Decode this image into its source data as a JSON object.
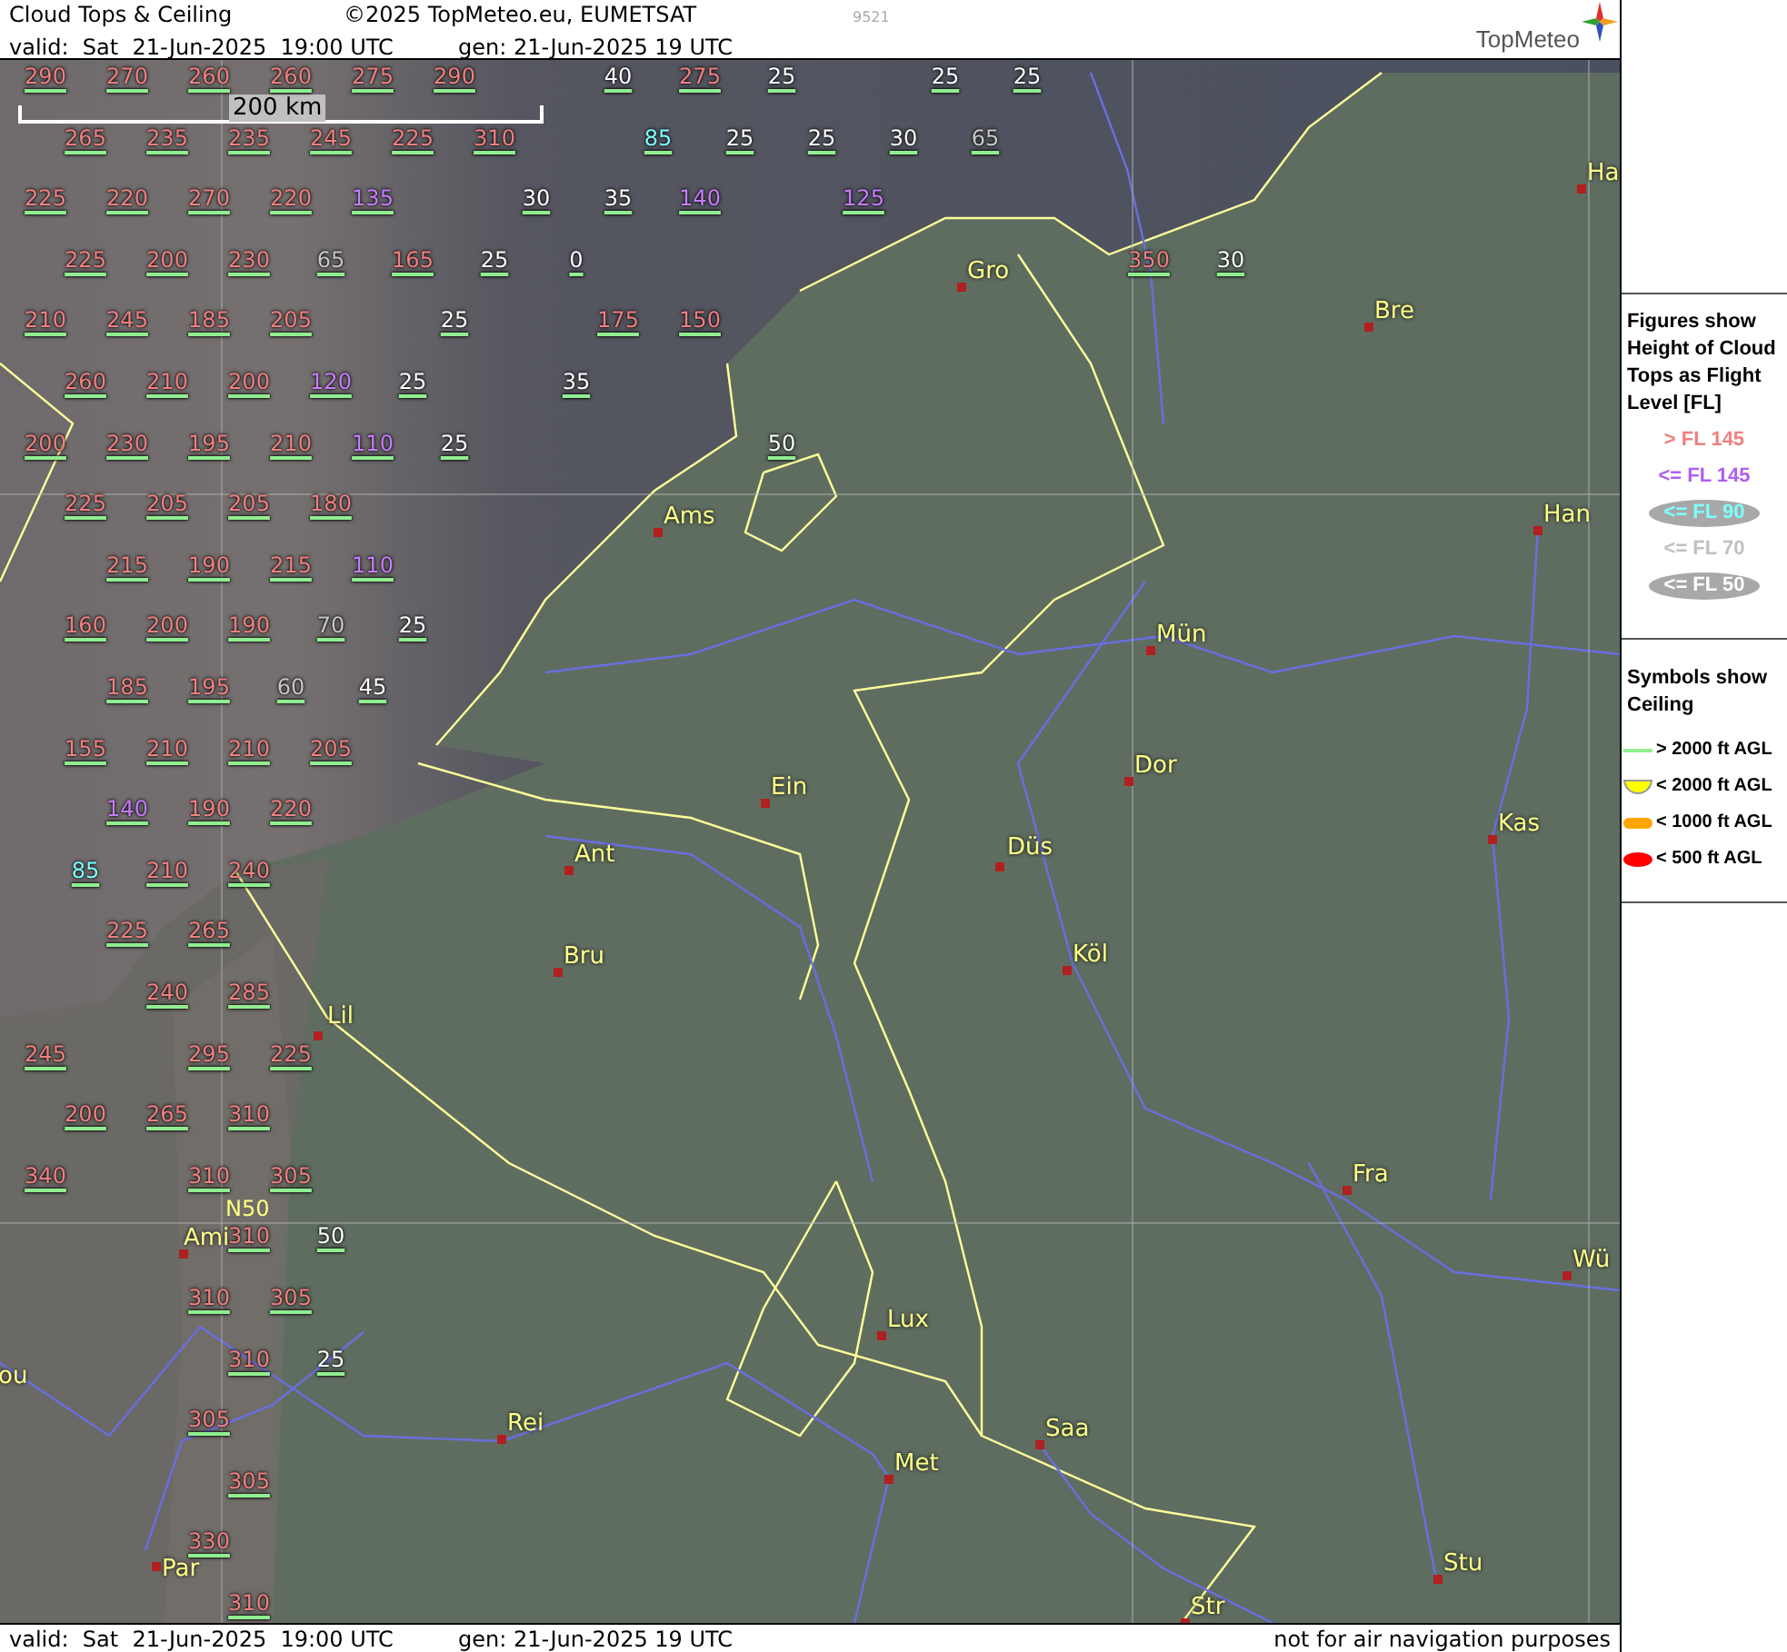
{
  "header": {
    "title": "Cloud Tops & Ceiling",
    "copyright": "©2025 TopMeteo.eu, EUMETSAT",
    "image_id": "9521",
    "valid": "valid:  Sat  21-Jun-2025  19:00 UTC",
    "generated": "gen: 21-Jun-2025 19 UTC",
    "logo": "TopMeteo"
  },
  "map": {
    "scale_bar": "200 km",
    "grid_label": "N50",
    "label_rows": [
      [
        {
          "text": "290",
          "kind": "gt145"
        },
        {
          "text": "270",
          "kind": "gt145"
        },
        {
          "text": "260",
          "kind": "gt145"
        },
        {
          "text": "260",
          "kind": "gt145"
        },
        {
          "text": "275",
          "kind": "gt145"
        },
        {
          "text": "290",
          "kind": "gt145"
        },
        {
          "text": "40",
          "kind": "le50"
        },
        {
          "text": "275",
          "kind": "gt145"
        },
        {
          "text": "25",
          "kind": "le50"
        },
        {
          "text": "25",
          "kind": "le50"
        },
        {
          "text": "25",
          "kind": "le50"
        }
      ],
      [
        {
          "text": "265",
          "kind": "gt145"
        },
        {
          "text": "235",
          "kind": "gt145"
        },
        {
          "text": "235",
          "kind": "gt145"
        },
        {
          "text": "245",
          "kind": "gt145"
        },
        {
          "text": "225",
          "kind": "gt145"
        },
        {
          "text": "310",
          "kind": "gt145"
        },
        {
          "text": "85",
          "kind": "le90"
        },
        {
          "text": "25",
          "kind": "le50"
        },
        {
          "text": "25",
          "kind": "le50"
        },
        {
          "text": "30",
          "kind": "le50"
        },
        {
          "text": "65",
          "kind": "le70"
        }
      ],
      [
        {
          "text": "225",
          "kind": "gt145"
        },
        {
          "text": "220",
          "kind": "gt145"
        },
        {
          "text": "270",
          "kind": "gt145"
        },
        {
          "text": "220",
          "kind": "gt145"
        },
        {
          "text": "135",
          "kind": "le145"
        },
        {
          "text": "30",
          "kind": "le50"
        },
        {
          "text": "35",
          "kind": "le50"
        },
        {
          "text": "140",
          "kind": "le145"
        },
        {
          "text": "125",
          "kind": "le145"
        }
      ],
      [
        {
          "text": "225",
          "kind": "gt145"
        },
        {
          "text": "200",
          "kind": "gt145"
        },
        {
          "text": "230",
          "kind": "gt145"
        },
        {
          "text": "65",
          "kind": "le70"
        },
        {
          "text": "165",
          "kind": "gt145"
        },
        {
          "text": "25",
          "kind": "le50"
        },
        {
          "text": "0",
          "kind": "le50"
        },
        {
          "text": "350",
          "kind": "gt145"
        },
        {
          "text": "30",
          "kind": "le50"
        }
      ],
      [
        {
          "text": "210",
          "kind": "gt145"
        },
        {
          "text": "245",
          "kind": "gt145"
        },
        {
          "text": "185",
          "kind": "gt145"
        },
        {
          "text": "205",
          "kind": "gt145"
        },
        {
          "text": "25",
          "kind": "le50"
        },
        {
          "text": "175",
          "kind": "gt145"
        },
        {
          "text": "150",
          "kind": "gt145"
        }
      ],
      [
        {
          "text": "260",
          "kind": "gt145"
        },
        {
          "text": "210",
          "kind": "gt145"
        },
        {
          "text": "200",
          "kind": "gt145"
        },
        {
          "text": "120",
          "kind": "le145"
        },
        {
          "text": "25",
          "kind": "le50"
        },
        {
          "text": "35",
          "kind": "le50"
        }
      ],
      [
        {
          "text": "200",
          "kind": "gt145"
        },
        {
          "text": "230",
          "kind": "gt145"
        },
        {
          "text": "195",
          "kind": "gt145"
        },
        {
          "text": "210",
          "kind": "gt145"
        },
        {
          "text": "110",
          "kind": "le145"
        },
        {
          "text": "25",
          "kind": "le50"
        },
        {
          "text": "50",
          "kind": "le50"
        }
      ],
      [
        {
          "text": "225",
          "kind": "gt145"
        },
        {
          "text": "205",
          "kind": "gt145"
        },
        {
          "text": "205",
          "kind": "gt145"
        },
        {
          "text": "180",
          "kind": "gt145"
        }
      ],
      [
        {
          "text": "215",
          "kind": "gt145"
        },
        {
          "text": "190",
          "kind": "gt145"
        },
        {
          "text": "215",
          "kind": "gt145"
        },
        {
          "text": "110",
          "kind": "le145"
        }
      ],
      [
        {
          "text": "160",
          "kind": "gt145"
        },
        {
          "text": "200",
          "kind": "gt145"
        },
        {
          "text": "190",
          "kind": "gt145"
        },
        {
          "text": "70",
          "kind": "le70"
        },
        {
          "text": "25",
          "kind": "le50"
        }
      ],
      [
        {
          "text": "185",
          "kind": "gt145"
        },
        {
          "text": "195",
          "kind": "gt145"
        },
        {
          "text": "60",
          "kind": "le70"
        },
        {
          "text": "45",
          "kind": "le50"
        }
      ],
      [
        {
          "text": "155",
          "kind": "gt145"
        },
        {
          "text": "210",
          "kind": "gt145"
        },
        {
          "text": "210",
          "kind": "gt145"
        },
        {
          "text": "205",
          "kind": "gt145"
        }
      ],
      [
        {
          "text": "140",
          "kind": "le145"
        },
        {
          "text": "190",
          "kind": "gt145"
        },
        {
          "text": "220",
          "kind": "gt145"
        }
      ],
      [
        {
          "text": "85",
          "kind": "le90"
        },
        {
          "text": "210",
          "kind": "gt145"
        },
        {
          "text": "240",
          "kind": "gt145"
        }
      ],
      [
        {
          "text": "225",
          "kind": "gt145"
        },
        {
          "text": "265",
          "kind": "gt145"
        }
      ],
      [
        {
          "text": "240",
          "kind": "gt145"
        },
        {
          "text": "285",
          "kind": "gt145"
        }
      ],
      [
        {
          "text": "245",
          "kind": "gt145"
        },
        {
          "text": "295",
          "kind": "gt145"
        },
        {
          "text": "225",
          "kind": "gt145"
        }
      ],
      [
        {
          "text": "200",
          "kind": "gt145"
        },
        {
          "text": "265",
          "kind": "gt145"
        },
        {
          "text": "310",
          "kind": "gt145"
        }
      ],
      [
        {
          "text": "340",
          "kind": "gt145"
        },
        {
          "text": "310",
          "kind": "gt145"
        },
        {
          "text": "305",
          "kind": "gt145"
        }
      ],
      [
        {
          "text": "310",
          "kind": "gt145"
        },
        {
          "text": "50",
          "kind": "le50"
        }
      ],
      [
        {
          "text": "310",
          "kind": "gt145"
        },
        {
          "text": "305",
          "kind": "gt145"
        }
      ],
      [
        {
          "text": "310",
          "kind": "gt145"
        },
        {
          "text": "25",
          "kind": "le50"
        }
      ],
      [
        {
          "text": "305",
          "kind": "gt145"
        }
      ],
      [
        {
          "text": "305",
          "kind": "gt145"
        }
      ],
      [
        {
          "text": "330",
          "kind": "gt145"
        }
      ],
      [
        {
          "text": "310",
          "kind": "gt145"
        }
      ]
    ],
    "cities": [
      {
        "name": "Ha"
      },
      {
        "name": "Gro"
      },
      {
        "name": "Bre"
      },
      {
        "name": "Ams"
      },
      {
        "name": "Han"
      },
      {
        "name": "Mün"
      },
      {
        "name": "Dor"
      },
      {
        "name": "Ein"
      },
      {
        "name": "Kas"
      },
      {
        "name": "Düs"
      },
      {
        "name": "Ant"
      },
      {
        "name": "Köl"
      },
      {
        "name": "Bru"
      },
      {
        "name": "Lil"
      },
      {
        "name": "Fra"
      },
      {
        "name": "Ami"
      },
      {
        "name": "Wü"
      },
      {
        "name": "Lux"
      },
      {
        "name": "ou"
      },
      {
        "name": "Rei"
      },
      {
        "name": "Saa"
      },
      {
        "name": "Met"
      },
      {
        "name": "Par"
      },
      {
        "name": "Stu"
      },
      {
        "name": "Str"
      }
    ]
  },
  "legend": {
    "tops_title": "Figures show Height of Cloud Tops as Flight Level  [FL]",
    "tops_items": [
      {
        "text": "> FL 145",
        "kind": "gt145"
      },
      {
        "text": "<= FL 145",
        "kind": "le145"
      },
      {
        "text": "<= FL 90",
        "kind": "le90"
      },
      {
        "text": "<= FL 70",
        "kind": "le70"
      },
      {
        "text": "<= FL 50",
        "kind": "le50"
      }
    ],
    "ceiling_title": "Symbols show Ceiling",
    "ceiling_items": [
      {
        "text": "> 2000 ft AGL",
        "kind": "line",
        "color": "#90ee90"
      },
      {
        "text": "< 2000 ft AGL",
        "kind": "cup",
        "color": "#ffff00"
      },
      {
        "text": "< 1000 ft AGL",
        "kind": "bar",
        "color": "#ffa500"
      },
      {
        "text": "< 500 ft AGL",
        "kind": "blob",
        "color": "#ff0000"
      }
    ]
  },
  "footer": {
    "valid": "valid:  Sat  21-Jun-2025  19:00 UTC",
    "generated": "gen: 21-Jun-2025 19 UTC",
    "disclaimer": "not for air navigation purposes"
  }
}
